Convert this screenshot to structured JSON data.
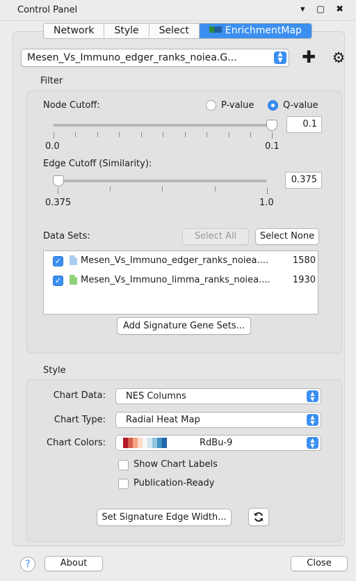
{
  "window": {
    "title": "Control Panel",
    "controls": "▾ ▢ ✖"
  },
  "tabs": [
    {
      "label": "Network"
    },
    {
      "label": "Style"
    },
    {
      "label": "Select"
    },
    {
      "label": "EnrichmentMap"
    }
  ],
  "network_select": {
    "value": "Mesen_Vs_Immuno_edger_ranks_noiea.G..."
  },
  "filter": {
    "label": "Filter",
    "node_cutoff": {
      "label": "Node Cutoff:",
      "radio_p": "P-value",
      "radio_q": "Q-value",
      "selected": "Q-value",
      "min_label": "0.0",
      "max_label": "0.1",
      "value": "0.1"
    },
    "edge_cutoff": {
      "label": "Edge Cutoff (Similarity):",
      "min_label": "0.375",
      "max_label": "1.0",
      "value": "0.375"
    },
    "data_sets": {
      "label": "Data Sets:",
      "select_all": "Select All",
      "select_none": "Select None",
      "items": [
        {
          "name": "Mesen_Vs_Immuno_edger_ranks_noiea....",
          "count": "1580",
          "checked": true,
          "color": "#a9cdf0"
        },
        {
          "name": "Mesen_Vs_Immuno_limma_ranks_noiea....",
          "count": "1930",
          "checked": true,
          "color": "#8fd17a"
        }
      ]
    },
    "add_signature": "Add Signature Gene Sets..."
  },
  "style": {
    "label": "Style",
    "chart_data_label": "Chart Data:",
    "chart_data_value": "NES Columns",
    "chart_type_label": "Chart Type:",
    "chart_type_value": "Radial Heat Map",
    "chart_colors_label": "Chart Colors:",
    "chart_colors_value": "RdBu-9",
    "show_labels": "Show Chart Labels",
    "publication_ready": "Publication-Ready",
    "set_edge_width": "Set Signature Edge Width...",
    "palette": [
      "#b2182b",
      "#d6604d",
      "#f4a582",
      "#fddbc7",
      "#f7f7f7",
      "#d1e5f0",
      "#92c5de",
      "#4393c3",
      "#2166ac"
    ]
  },
  "footer": {
    "help": "?",
    "about": "About",
    "close": "Close"
  }
}
